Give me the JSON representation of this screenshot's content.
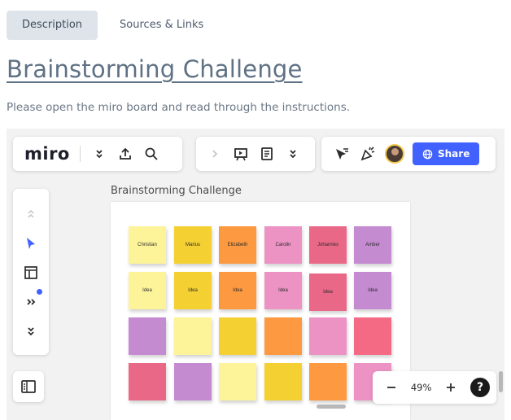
{
  "tabs": [
    {
      "label": "Description",
      "active": true
    },
    {
      "label": "Sources & Links",
      "active": false
    }
  ],
  "title": "Brainstorming Challenge",
  "description": "Please open the miro board and read through the instructions.",
  "miro": {
    "logo": "miro",
    "share_label": "Share",
    "board_label": "Brainstorming Challenge",
    "zoom_level": "49%",
    "help_label": "?",
    "accent_color": "#4262ff",
    "notes": {
      "row1": [
        "Christian",
        "Marius",
        "Elizabeth",
        "Carolin",
        "Johannes",
        "Amber"
      ],
      "row2": [
        "Idea",
        "Idea",
        "Idea",
        "Idea",
        "Idea",
        "Idea"
      ]
    },
    "note_colors": {
      "row1": [
        "#fdf49a",
        "#f5d033",
        "#fd9940",
        "#ec93c4",
        "#ea6887",
        "#c58bd1"
      ],
      "row2": [
        "#fdf49a",
        "#f5d033",
        "#fd9940",
        "#ec93c4",
        "#ea6887",
        "#c58bd1"
      ],
      "row3": [
        "#c58bd1",
        "#fdf49a",
        "#f5d033",
        "#fd9940",
        "#ec93c4",
        "#f46a84"
      ],
      "row4": [
        "#ea6887",
        "#c58bd1",
        "#fdf49a",
        "#f5d033",
        "#fd9940",
        "#ec93c4"
      ]
    }
  }
}
